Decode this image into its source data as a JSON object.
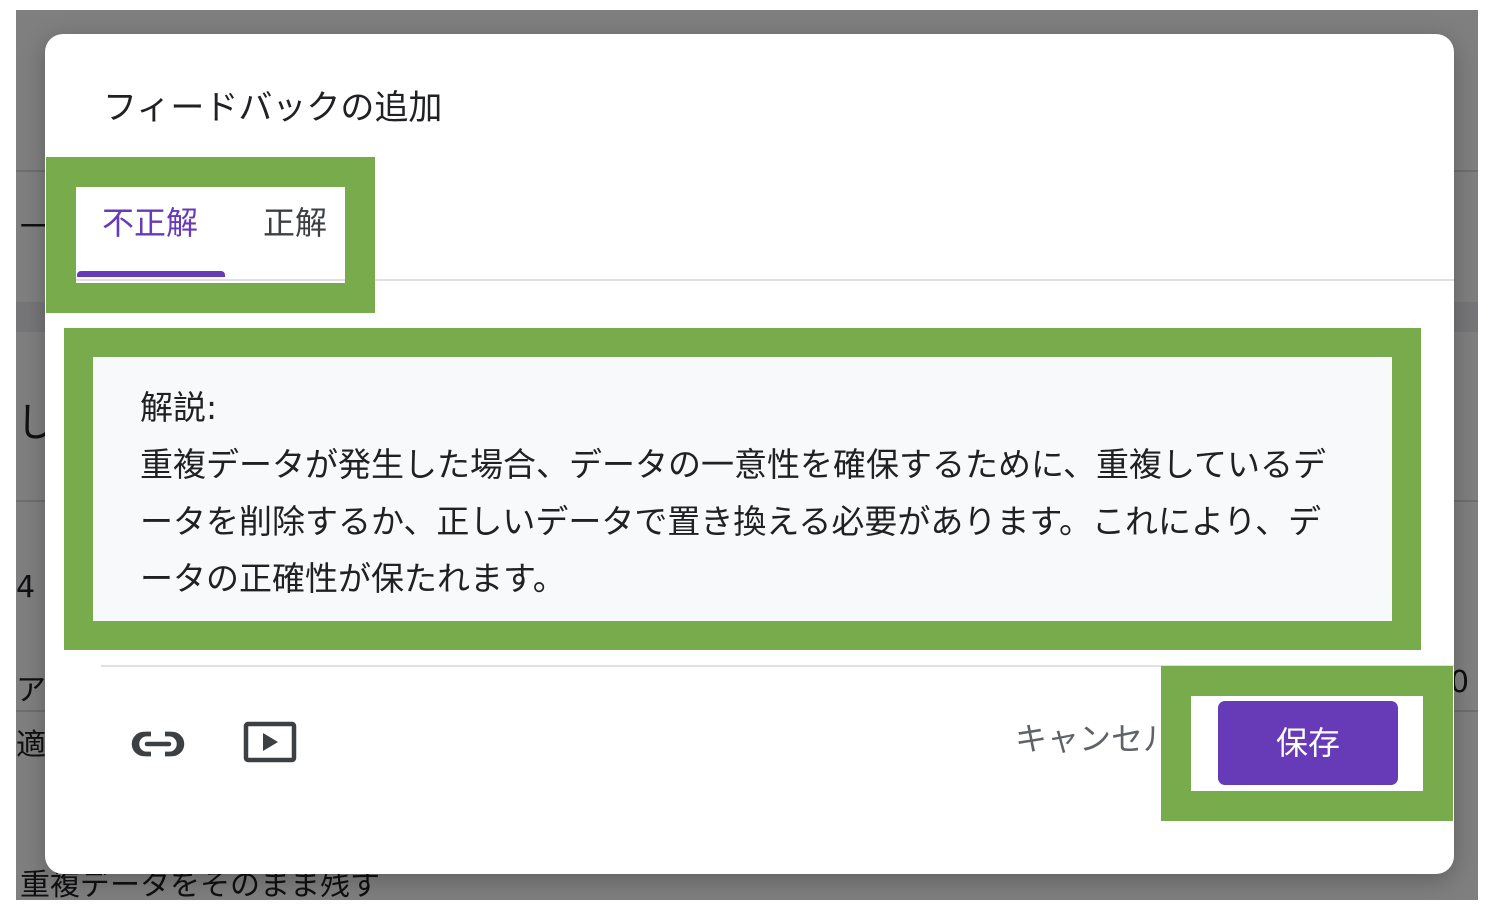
{
  "background": {
    "fragments": [
      "一",
      "し",
      "4",
      "ア",
      "適",
      "0",
      "重複データをそのまま残す"
    ]
  },
  "dialog": {
    "title": "フィードバックの追加",
    "tabs": [
      {
        "label": "不正解",
        "active": true
      },
      {
        "label": "正解",
        "active": false
      }
    ],
    "feedback": {
      "label": "解説:",
      "body": "重複データが発生した場合、データの一意性を確保するために、重複しているデータを削除するか、正しいデータで置き換える必要があります。これにより、データの正確性が保たれます。"
    },
    "toolbar": {
      "link_icon": "link-icon",
      "video_icon": "video-icon"
    },
    "actions": {
      "cancel_label": "キャンセル",
      "save_label": "保存"
    }
  },
  "colors": {
    "accent": "#673ab7",
    "highlight": "#78ab4b",
    "scrim": "#808080"
  }
}
